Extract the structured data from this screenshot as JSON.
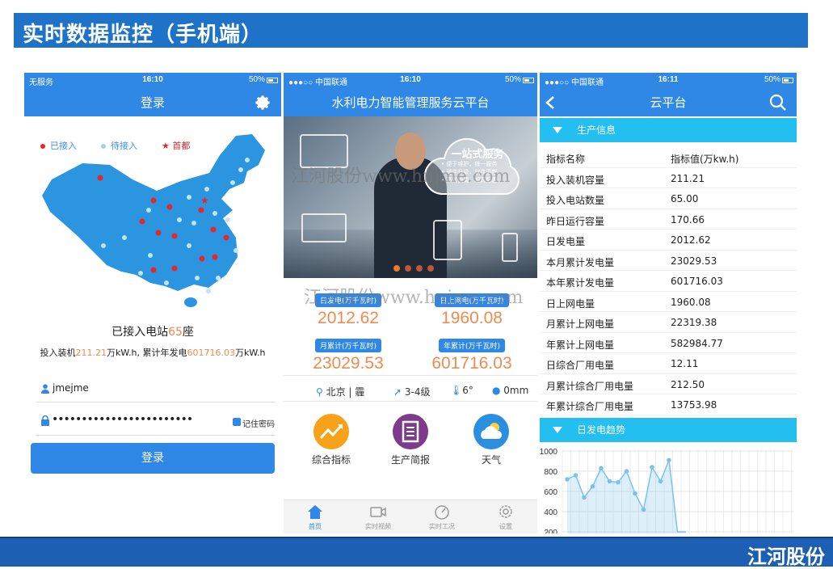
{
  "slide": {
    "title": "实时数据监控（手机端）",
    "footer_brand": "江河股份",
    "watermark_1": "江河股份www.hnjme.com",
    "watermark_2": "江河股份www.hnjme.com"
  },
  "phone_login": {
    "status": {
      "carrier": "无服务",
      "time": "16:10",
      "battery": "50%"
    },
    "nav_title": "登录",
    "legend": [
      {
        "label": "已接入",
        "color": "#e8262a"
      },
      {
        "label": "待接入",
        "color": "#9ed2f5"
      },
      {
        "label": "首都",
        "color": "#e8262a"
      }
    ],
    "stations_prefix": "已接入电站",
    "stations_count": "65",
    "stations_suffix": "座",
    "capacity_prefix": "投入装机",
    "capacity_value": "211.21",
    "capacity_unit": "万kW.h,",
    "gen_prefix": " 累计年发电",
    "gen_value": "601716.03",
    "gen_unit": "万kW.h",
    "username": "jmejme",
    "password_mask": "••••••••••••••••••••••••",
    "remember_label": "记住密码",
    "login_button": "登录"
  },
  "phone_home": {
    "status": {
      "carrier": "●●●○○ 中国联通",
      "time": "16:10",
      "battery": "50%"
    },
    "nav_title": "水利电力智能管理服务云平台",
    "banner": {
      "heading": "一站式服务",
      "lines": [
        "• 便于维护，统一服务",
        "• 硬件升级，软件更新",
        "• 高效快捷，超高配置"
      ]
    },
    "stats": [
      {
        "label": "日发电(万千瓦时)",
        "value": "2012.62"
      },
      {
        "label": "日上网电(万千瓦时)",
        "value": "1960.08"
      },
      {
        "label": "月累计(万千瓦时)",
        "value": "23029.53"
      },
      {
        "label": "年累计(万千瓦时)",
        "value": "601716.03"
      }
    ],
    "weather": {
      "city": "北京 | 霾",
      "wind": "3-4级",
      "temp": "6°",
      "rain": "0mm"
    },
    "apps": [
      {
        "label": "综合指标",
        "color": "#f7a21b"
      },
      {
        "label": "生产简报",
        "color": "#7e3b8c"
      },
      {
        "label": "天气",
        "color": "#2b8fe0"
      }
    ],
    "tabs": [
      "首页",
      "实时视频",
      "实时工况",
      "设置"
    ],
    "colors": {
      "accent": "#2f87e6",
      "value": "#ef8b4f"
    }
  },
  "phone_cloud": {
    "status": {
      "carrier": "●●●○○ 中国联通",
      "time": "16:11",
      "battery": "50%"
    },
    "nav_title": "云平台",
    "section_production": "生产信息",
    "table_header": [
      "指标名称",
      "指标值(万kw.h)"
    ],
    "rows": [
      [
        "投入装机容量",
        "211.21"
      ],
      [
        "投入电站数量",
        "65.00"
      ],
      [
        "昨日运行容量",
        "170.66"
      ],
      [
        "日发电量",
        "2012.62"
      ],
      [
        "本月累计发电量",
        "23029.53"
      ],
      [
        "本年累计发电量",
        "601716.03"
      ],
      [
        "日上网电量",
        "1960.08"
      ],
      [
        "月累计上网电量",
        "22319.38"
      ],
      [
        "年累计上网电量",
        "582984.77"
      ],
      [
        "日综合厂用电量",
        "12.11"
      ],
      [
        "月累计综合厂用电量",
        "212.50"
      ],
      [
        "年累计综合厂用电量",
        "13753.98"
      ]
    ],
    "section_trend": "日发电趋势",
    "chart_data": {
      "type": "area",
      "x": [
        1,
        2,
        3,
        4,
        5,
        6,
        7,
        8,
        9,
        10,
        11,
        12,
        13,
        14,
        15
      ],
      "values": [
        720,
        760,
        540,
        650,
        830,
        700,
        690,
        800,
        580,
        420,
        840,
        700,
        910,
        200,
        200
      ],
      "ylim": [
        200,
        1000
      ],
      "yticks": [
        "1000",
        "800",
        "600",
        "400",
        "200"
      ],
      "grid": true
    }
  }
}
